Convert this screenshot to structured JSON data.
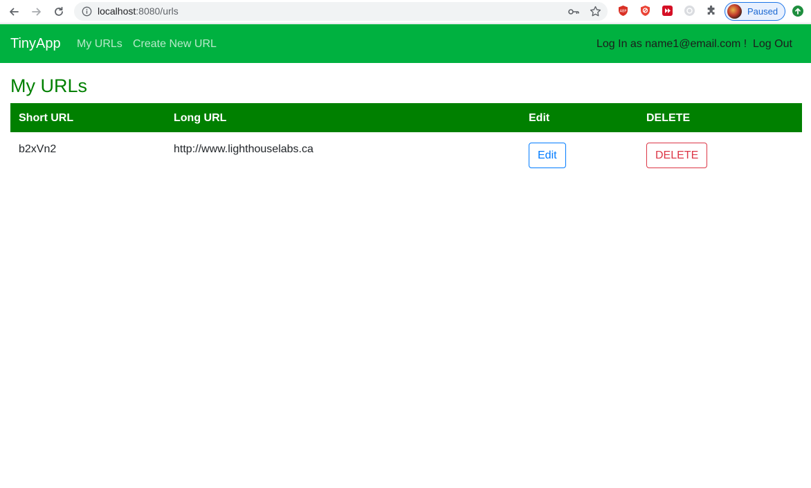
{
  "browser": {
    "url_host": "localhost",
    "url_rest": ":8080/urls",
    "profile_label": "Paused"
  },
  "navbar": {
    "brand": "TinyApp",
    "links": [
      "My URLs",
      "Create New URL"
    ],
    "login_status": "Log In as name1@email.com !",
    "logout": "Log Out",
    "colors": {
      "bar": "#00b140",
      "text": "#ffffff"
    }
  },
  "page": {
    "title": "My URLs",
    "accent_color": "#008000"
  },
  "table": {
    "headers": [
      "Short URL",
      "Long URL",
      "Edit",
      "DELETE"
    ],
    "rows": [
      {
        "short_url": "b2xVn2",
        "long_url": "http://www.lighthouselabs.ca",
        "edit_label": "Edit",
        "delete_label": "DELETE"
      }
    ]
  }
}
